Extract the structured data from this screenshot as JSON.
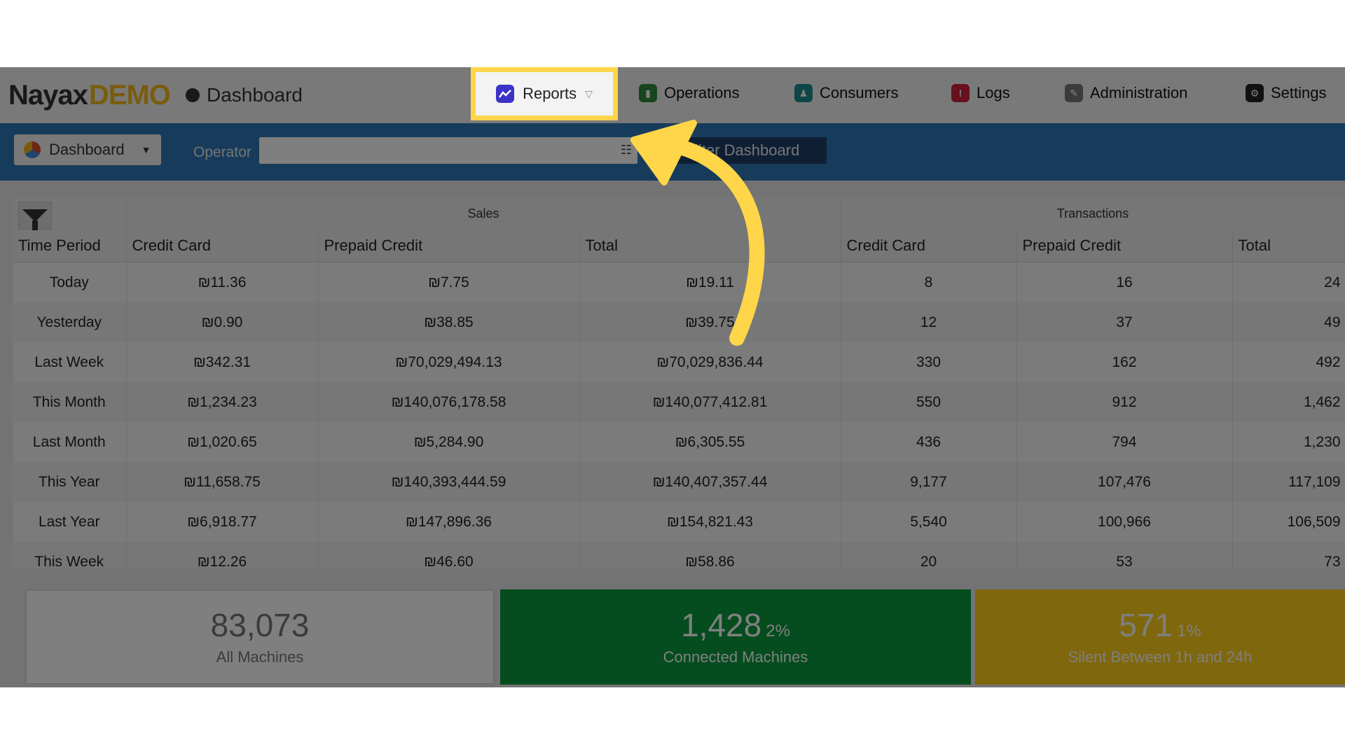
{
  "nav": {
    "logo_main": "Nayax",
    "logo_accent": "DEMO",
    "breadcrumb": "Dashboard",
    "items": [
      {
        "label": "Reports",
        "icon": "chart-icon"
      },
      {
        "label": "Operations",
        "icon": "operations-icon"
      },
      {
        "label": "Consumers",
        "icon": "consumers-icon"
      },
      {
        "label": "Logs",
        "icon": "logs-icon"
      },
      {
        "label": "Administration",
        "icon": "administration-icon"
      },
      {
        "label": "Settings",
        "icon": "gear-icon"
      }
    ]
  },
  "filterbar": {
    "dashboard_label": "Dashboard",
    "operator_label": "Operator",
    "operator_value": "",
    "filter_button": "Filter Dashboard"
  },
  "table": {
    "group_sales": "Sales",
    "group_transactions": "Transactions",
    "headers": [
      "Time Period",
      "Credit Card",
      "Prepaid Credit",
      "Total",
      "Credit Card",
      "Prepaid Credit",
      "Total"
    ],
    "rows": [
      [
        "Today",
        "₪11.36",
        "₪7.75",
        "₪19.11",
        "8",
        "16",
        "24"
      ],
      [
        "Yesterday",
        "₪0.90",
        "₪38.85",
        "₪39.75",
        "12",
        "37",
        "49"
      ],
      [
        "Last Week",
        "₪342.31",
        "₪70,029,494.13",
        "₪70,029,836.44",
        "330",
        "162",
        "492"
      ],
      [
        "This Month",
        "₪1,234.23",
        "₪140,076,178.58",
        "₪140,077,412.81",
        "550",
        "912",
        "1,462"
      ],
      [
        "Last Month",
        "₪1,020.65",
        "₪5,284.90",
        "₪6,305.55",
        "436",
        "794",
        "1,230"
      ],
      [
        "This Year",
        "₪11,658.75",
        "₪140,393,444.59",
        "₪140,407,357.44",
        "9,177",
        "107,476",
        "117,109"
      ],
      [
        "Last Year",
        "₪6,918.77",
        "₪147,896.36",
        "₪154,821.43",
        "5,540",
        "100,966",
        "106,509"
      ],
      [
        "This Week",
        "₪12.26",
        "₪46.60",
        "₪58.86",
        "20",
        "53",
        "73"
      ]
    ]
  },
  "cards": [
    {
      "value": "83,073",
      "percent": "",
      "label": "All Machines"
    },
    {
      "value": "1,428",
      "percent": "2%",
      "label": "Connected Machines"
    },
    {
      "value": "571",
      "percent": "1%",
      "label": "Silent Between 1h and 24h"
    }
  ],
  "colors": {
    "filterbar": "#2f78b6",
    "connected": "#0a9b3d",
    "silent": "#ffce1a",
    "highlight": "#ffd54a",
    "reports_icon": "#3b33c7"
  }
}
